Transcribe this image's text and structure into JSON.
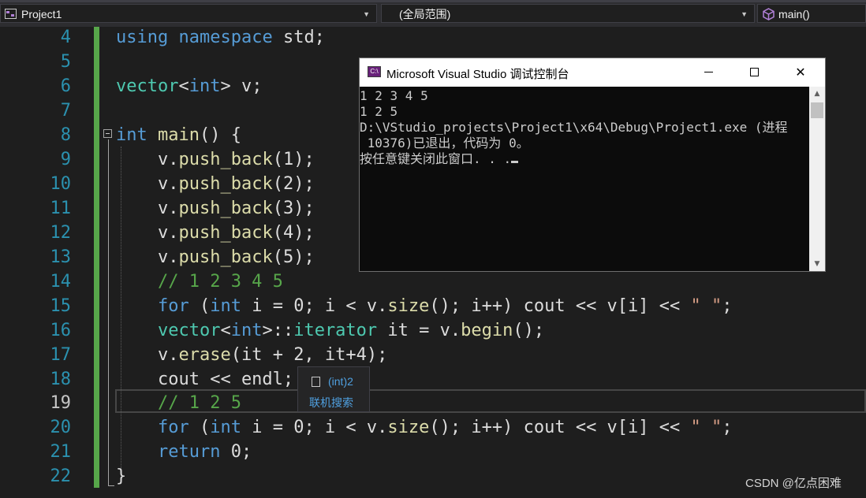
{
  "navbar": {
    "project_combo": "Project1",
    "scope_combo": "(全局范围)",
    "member_combo": "main()"
  },
  "editor": {
    "lines": [
      {
        "num": "4"
      },
      {
        "num": "5"
      },
      {
        "num": "6"
      },
      {
        "num": "7"
      },
      {
        "num": "8"
      },
      {
        "num": "9"
      },
      {
        "num": "10"
      },
      {
        "num": "11"
      },
      {
        "num": "12"
      },
      {
        "num": "13"
      },
      {
        "num": "14"
      },
      {
        "num": "15"
      },
      {
        "num": "16"
      },
      {
        "num": "17"
      },
      {
        "num": "18"
      },
      {
        "num": "19"
      },
      {
        "num": "20"
      },
      {
        "num": "21"
      },
      {
        "num": "22"
      }
    ],
    "code": {
      "l4_kw1": "using",
      "l4_kw2": "namespace",
      "l4_rest": " std;",
      "l6_cls": "vector",
      "l6_lt": "<",
      "l6_kw": "int",
      "l6_rest": "> v;",
      "l8_kw": "int",
      "l8_fn": " main",
      "l8_rest": "() {",
      "l9": "    v.",
      "l9_fn": "push_back",
      "l9_rest": "(1);",
      "l10": "    v.",
      "l10_fn": "push_back",
      "l10_rest": "(2);",
      "l11": "    v.",
      "l11_fn": "push_back",
      "l11_rest": "(3);",
      "l12": "    v.",
      "l12_fn": "push_back",
      "l12_rest": "(4);",
      "l13": "    v.",
      "l13_fn": "push_back",
      "l13_rest": "(5);",
      "l14_cm": "    // 1 2 3 4 5",
      "l15_for": "    for",
      "l15_a": " (",
      "l15_int": "int",
      "l15_b": " i = 0; i < v.",
      "l15_size": "size",
      "l15_c": "(); i++) cout << v[i] << ",
      "l15_str": "\" \"",
      "l15_d": ";",
      "l16_cls": "    vector",
      "l16_a": "<",
      "l16_int": "int",
      "l16_b": ">::",
      "l16_it": "iterator",
      "l16_c": " it = v.",
      "l16_begin": "begin",
      "l16_d": "();",
      "l17_a": "    v.",
      "l17_erase": "erase",
      "l17_b": "(it + 2, it+4);",
      "l18": "    cout << endl;",
      "l19_cm": "    // 1 2 5",
      "l20_for": "    for",
      "l20_a": " (",
      "l20_int": "int",
      "l20_b": " i = 0; i < v.",
      "l20_size": "size",
      "l20_c": "(); i++) cout << v[i] << ",
      "l20_str": "\" \"",
      "l20_d": ";",
      "l21_kw": "    return",
      "l21_rest": " 0;",
      "l22": "}"
    }
  },
  "tooltip": {
    "type_text": "(int)2",
    "search_text": "联机搜索"
  },
  "console": {
    "icon_text": "C:\\",
    "title": "Microsoft Visual Studio 调试控制台",
    "min_label": "—",
    "close_label": "✕",
    "lines": [
      "1 2 3 4 5",
      "1 2 5",
      "D:\\VStudio_projects\\Project1\\x64\\Debug\\Project1.exe (进程",
      " 10376)已退出，代码为 0。",
      "按任意键关闭此窗口. . ."
    ],
    "scroll_up": "▲",
    "scroll_down": "▼"
  },
  "watermark": "CSDN @亿点困难"
}
